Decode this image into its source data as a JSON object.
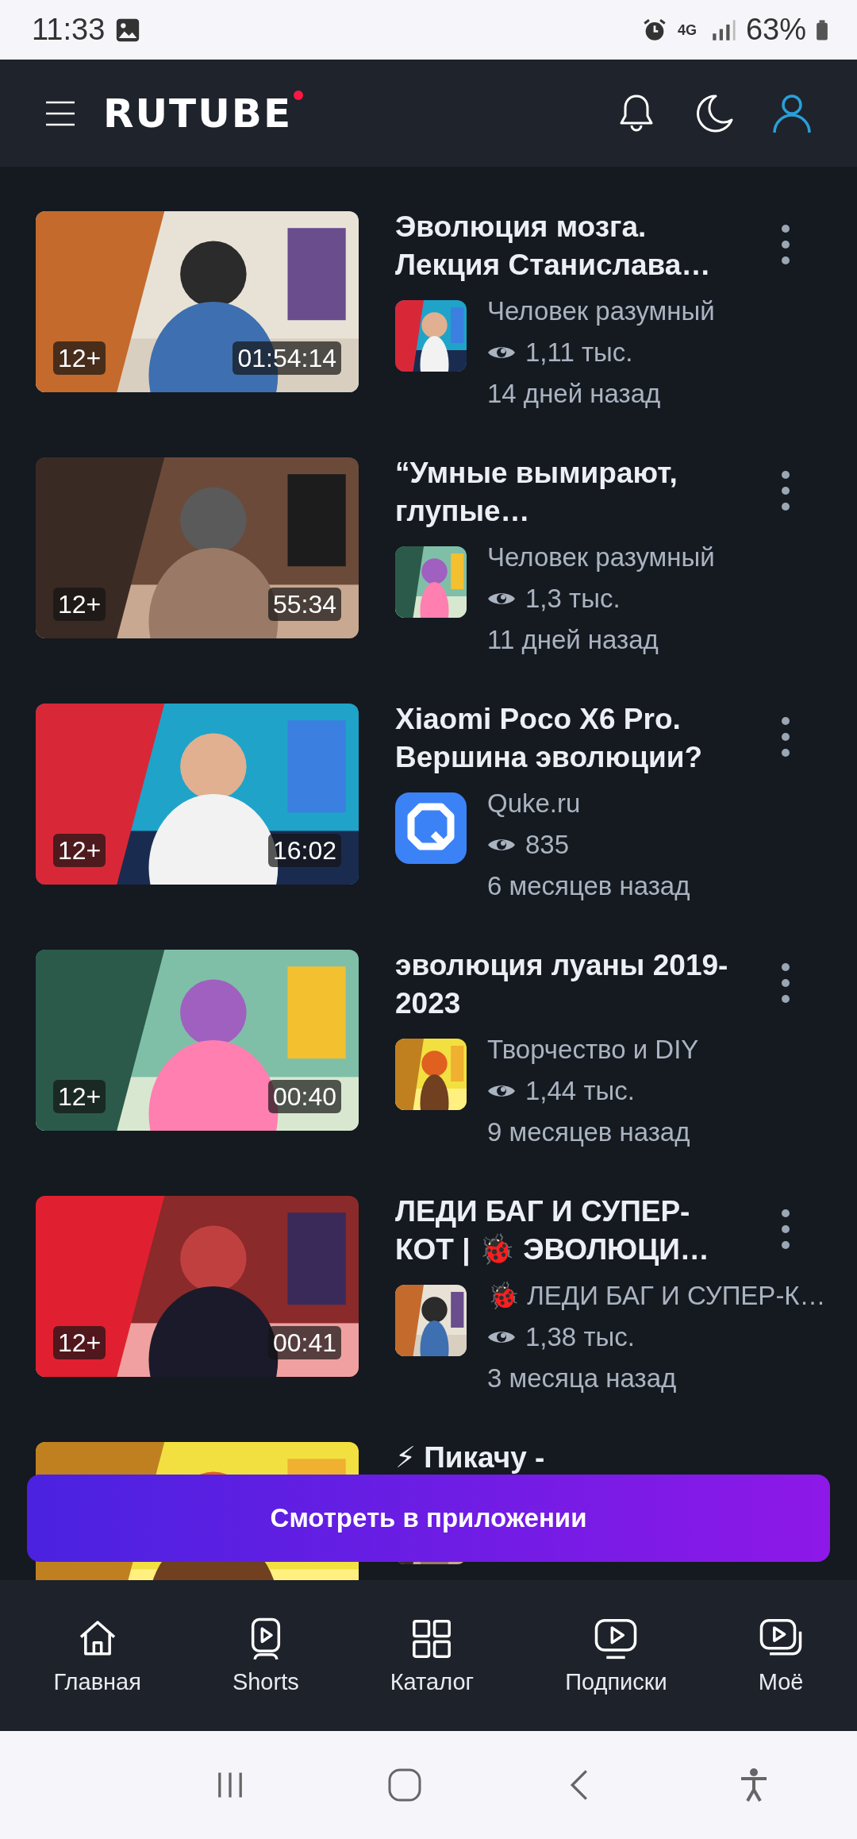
{
  "status_bar": {
    "time": "11:33",
    "battery": "63%",
    "network": "4G"
  },
  "header": {
    "logo": "RUTUBE"
  },
  "videos": [
    {
      "title": "Эволюция мозга. Лекция Станислава…",
      "channel": "Человек разумный",
      "views": "1,11 тыс.",
      "age": "14 дней назад",
      "rating": "12+",
      "duration": "01:54:14",
      "kind": "picture"
    },
    {
      "title": "“Умные вымирают, глупые…",
      "channel": "Человек разумный",
      "views": "1,3 тыс.",
      "age": "11 дней назад",
      "rating": "12+",
      "duration": "55:34",
      "kind": "picture"
    },
    {
      "title": "Xiaomi Poco X6 Pro. Вершина эволюции?",
      "channel": "Quke.ru",
      "views": "835",
      "age": "6 месяцев назад",
      "rating": "12+",
      "duration": "16:02",
      "kind": "logo"
    },
    {
      "title": "эволюция луаны 2019-2023",
      "channel": "Творчество и DIY",
      "views": "1,44 тыс.",
      "age": "9 месяцев назад",
      "rating": "12+",
      "duration": "00:40",
      "kind": "picture"
    },
    {
      "title": "ЛЕДИ БАГ И СУПЕР-КОТ | 🐞 ЭВОЛЮЦИ…",
      "channel": "🐞 ЛЕДИ БАГ И СУПЕР-К…",
      "views": "1,38 тыс.",
      "age": "3 месяца назад",
      "rating": "12+",
      "duration": "00:41",
      "kind": "picture"
    },
    {
      "title": "⚡ Пикачу -",
      "kind": "picture"
    }
  ],
  "app_button": "Смотреть в приложении",
  "nav": [
    {
      "label": "Главная",
      "selected": false
    },
    {
      "label": "Shorts",
      "selected": false
    },
    {
      "label": "Каталог",
      "selected": false
    },
    {
      "label": "Подписки",
      "selected": false
    },
    {
      "label": "Моё",
      "selected": false
    }
  ]
}
